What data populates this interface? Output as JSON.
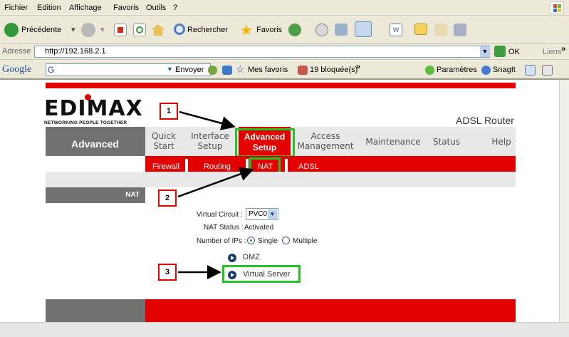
{
  "browser": {
    "menu": [
      "Fichier",
      "Edition",
      "Affichage",
      "Favoris",
      "Outils",
      "?"
    ],
    "toolbar": {
      "back": "Précédente",
      "search": "Rechercher",
      "favorites": "Favoris"
    },
    "address": {
      "label": "Adresse",
      "url": "http://192.168.2.1",
      "go": "OK",
      "links": "Liens"
    },
    "google": {
      "logo": "Google",
      "g_field": "G",
      "send": "Envoyer",
      "my_favorites": "Mes favoris",
      "blocked": "19 bloquée(s)",
      "settings": "Paramètres",
      "snagit": "SnagIt"
    }
  },
  "router": {
    "brand": "EDIMAX",
    "tagline": "NETWORKING PEOPLE TOGETHER",
    "product": "ADSL Router",
    "section_title": "Advanced",
    "nav": [
      {
        "line1": "Quick",
        "line2": "Start"
      },
      {
        "line1": "Interface",
        "line2": "Setup"
      },
      {
        "line1": "Advanced",
        "line2": "Setup"
      },
      {
        "line1": "Access",
        "line2": "Management"
      },
      {
        "line1": "Maintenance",
        "line2": ""
      },
      {
        "line1": "Status",
        "line2": ""
      },
      {
        "line1": "Help",
        "line2": ""
      }
    ],
    "subnav": [
      "Firewall",
      "Routing",
      "NAT",
      "ADSL"
    ],
    "side_label": "NAT",
    "form": {
      "virtual_circuit_label": "Virtual Circuit :",
      "virtual_circuit_value": "PVC0",
      "nat_status_label": "NAT Status :",
      "nat_status_value": "Activated",
      "num_ips_label": "Number of IPs :",
      "option_single": "Single",
      "option_multiple": "Multiple",
      "selected": "Single"
    },
    "links": [
      "DMZ",
      "Virtual Server"
    ]
  },
  "callouts": [
    "1",
    "2",
    "3"
  ],
  "colors": {
    "brand_red": "#e30000",
    "highlight_green": "#22c322",
    "callout_red": "#e60000"
  }
}
